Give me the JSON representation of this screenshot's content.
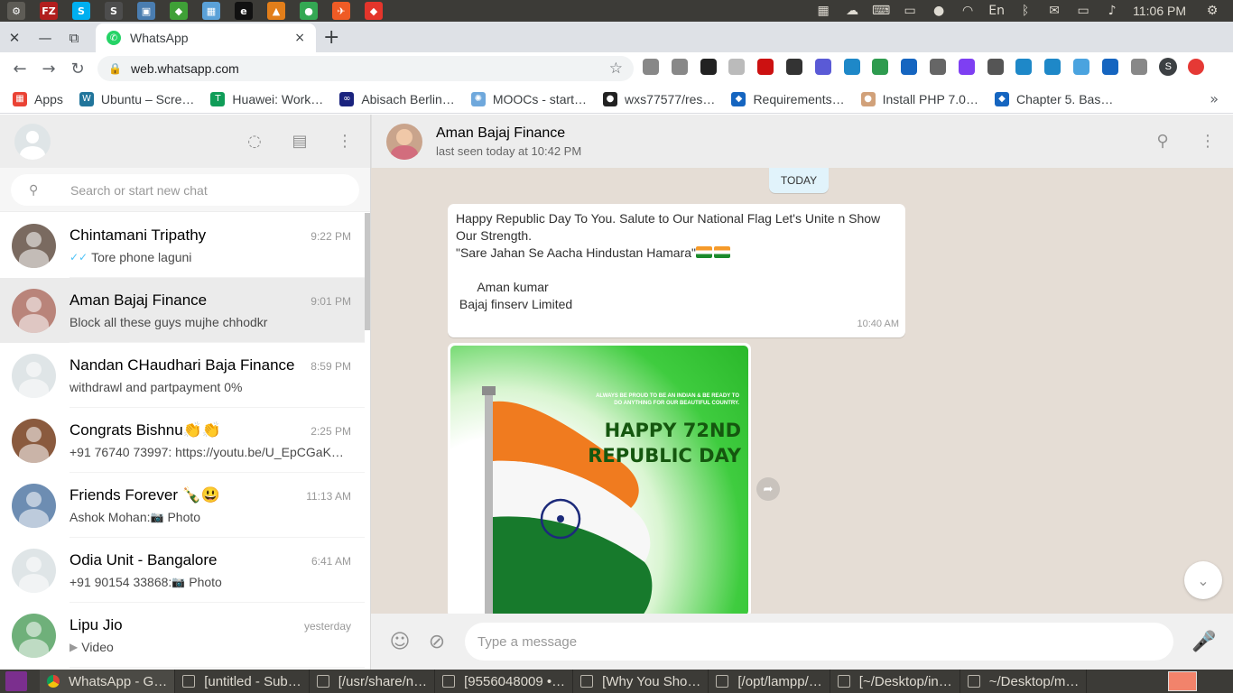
{
  "system_bar": {
    "launchers": [
      {
        "icon": "settings-gear-icon",
        "color": "#5e5c56",
        "glyph": "⚙"
      },
      {
        "icon": "filezilla-icon",
        "color": "#b11e1e",
        "glyph": "FZ"
      },
      {
        "icon": "skype-icon",
        "color": "#00aff0",
        "glyph": "S"
      },
      {
        "icon": "sublime-text-icon",
        "color": "#4d4d4d",
        "glyph": "S"
      },
      {
        "icon": "virtualbox-icon",
        "color": "#4a7db0",
        "glyph": "▣"
      },
      {
        "icon": "mongodb-icon",
        "color": "#3fa037",
        "glyph": "◆"
      },
      {
        "icon": "image-viewer-icon",
        "color": "#5aa1d8",
        "glyph": "▦"
      },
      {
        "icon": "eboard-icon",
        "color": "#111111",
        "glyph": "e"
      },
      {
        "icon": "vlc-icon",
        "color": "#e27e1a",
        "glyph": "▲"
      },
      {
        "icon": "chrome-icon",
        "color": "#34a853",
        "glyph": "●"
      },
      {
        "icon": "postman-icon",
        "color": "#ef5b25",
        "glyph": "✈"
      },
      {
        "icon": "anydesk-icon",
        "color": "#e4352b",
        "glyph": "◆"
      }
    ],
    "tray": [
      {
        "icon": "apps-grid-tray-icon",
        "glyph": "▦"
      },
      {
        "icon": "skype-tray-icon",
        "glyph": "☁"
      },
      {
        "icon": "keyboard-icon",
        "glyph": "⌨"
      },
      {
        "icon": "terminal-icon",
        "glyph": "▭"
      },
      {
        "icon": "red-app-icon",
        "glyph": "●"
      },
      {
        "icon": "wifi-icon",
        "glyph": "◠"
      },
      {
        "icon": "language-icon",
        "glyph": "En"
      },
      {
        "icon": "bluetooth-icon",
        "glyph": "ᛒ"
      },
      {
        "icon": "mail-icon",
        "glyph": "✉"
      },
      {
        "icon": "battery-icon",
        "glyph": "▭"
      },
      {
        "icon": "volume-icon",
        "glyph": "♪"
      }
    ],
    "clock": "11:06 PM",
    "power_glyph": "⚙"
  },
  "browser": {
    "tab_title": "WhatsApp",
    "tab_close": "×",
    "new_tab": "+",
    "url": "web.whatsapp.com",
    "back": "←",
    "forward": "→",
    "reload": "↻",
    "lock": "🔒",
    "star": "☆",
    "close_window": "✕",
    "minimize": "—",
    "restore": "⧉",
    "extension_colors": [
      "#888888",
      "#888888",
      "#222222",
      "#bbbbbb",
      "#cc1111",
      "#333333",
      "#5a5ad6",
      "#1e88c8",
      "#2e9b4f",
      "#1565c0",
      "#666666",
      "#7e3ff2",
      "#555555",
      "#1e88c8",
      "#1e88c8",
      "#4aa3df",
      "#1565c0",
      "#888888"
    ],
    "profile_letter": "S",
    "bookmarks": [
      {
        "label": "Apps",
        "color": "#ea4335",
        "glyph": "▦"
      },
      {
        "label": "Ubuntu – Scre…",
        "color": "#21759b",
        "glyph": "W"
      },
      {
        "label": "Huawei: Work…",
        "color": "#0f9d58",
        "glyph": "T"
      },
      {
        "label": "Abisach Berlin…",
        "color": "#1a237e",
        "glyph": "∞"
      },
      {
        "label": "MOOCs - start…",
        "color": "#6fa8dc",
        "glyph": "✺"
      },
      {
        "label": "wxs77577/res…",
        "color": "#222222",
        "glyph": "●"
      },
      {
        "label": "Requirements…",
        "color": "#1565c0",
        "glyph": "◆"
      },
      {
        "label": "Install PHP 7.0…",
        "color": "#d1a17a",
        "glyph": "●"
      },
      {
        "label": "Chapter 5. Bas…",
        "color": "#1565c0",
        "glyph": "◆"
      }
    ],
    "bookmarks_more": "»"
  },
  "left_panel": {
    "header_icons": [
      "status-icon",
      "new-chat-icon",
      "menu-icon"
    ],
    "header_glyphs": [
      "◌",
      "▤",
      "⋮"
    ],
    "search_placeholder": "Search or start new chat",
    "search_glyph": "⚲",
    "chats": [
      {
        "name": "Chintamani Tripathy",
        "time": "9:22 PM",
        "preview": "Tore phone laguni",
        "status_glyph": "✓✓",
        "status_icon": "double-check-icon",
        "avatar_color": "#7a6a60",
        "active": false
      },
      {
        "name": "Aman Bajaj Finance",
        "time": "9:01 PM",
        "preview": "Block all these guys mujhe chhodkr",
        "status_glyph": "",
        "status_icon": "",
        "avatar_color": "#b9847a",
        "active": true
      },
      {
        "name": "Nandan CHaudhari Baja Finance",
        "time": "8:59 PM",
        "preview": "withdrawl and partpayment 0%",
        "status_glyph": "",
        "status_icon": "",
        "avatar_color": "#dfe5e7",
        "active": false
      },
      {
        "name": "Congrats Bishnu👏👏",
        "time": "2:25 PM",
        "preview": "+91 76740 73997: https://youtu.be/U_EpCGaK…",
        "status_glyph": "",
        "status_icon": "",
        "avatar_color": "#8a5a3e",
        "active": false
      },
      {
        "name": "Friends Forever 🍾😃",
        "time": "11:13 AM",
        "preview": "Ashok Mohan: ",
        "preview_media": "Photo",
        "status_glyph": "📷",
        "status_icon": "camera-icon",
        "avatar_color": "#6d8db2",
        "active": false
      },
      {
        "name": "Odia Unit - Bangalore",
        "time": "6:41 AM",
        "preview": "+91 90154 33868: ",
        "preview_media": "Photo",
        "status_glyph": "📷",
        "status_icon": "camera-icon",
        "avatar_color": "#dfe5e7",
        "active": false
      },
      {
        "name": "Lipu Jio",
        "time": "yesterday",
        "preview": "",
        "preview_media": "Video",
        "status_glyph": "▶",
        "status_icon": "video-icon",
        "avatar_color": "#6fb07a",
        "active": false
      }
    ]
  },
  "conversation": {
    "name": "Aman Bajaj Finance",
    "status": "last seen today at 10:42 PM",
    "header_glyphs": [
      "⚲",
      "⋮"
    ],
    "day_chip": "TODAY",
    "message_text": "Happy Republic Day To You. Salute to Our National Flag Let's Unite n Show Our Strength.\n\"Sare Jahan Se Aacha Hindustan Hamara\"",
    "message_signature": "\n\n      Aman kumar\n Bajaj finserv Limited",
    "message_time": "10:40 AM",
    "poster_tagline": "ALWAYS BE PROUD TO BE AN INDIAN & BE READY TO DO ANYTHING FOR OUR BEAUTIFUL COUNTRY.",
    "poster_heading_1": "HAPPY 72ND",
    "poster_heading_2": "REPUBLIC DAY",
    "forward_glyph": "➦",
    "scroll_glyph": "⌄",
    "composer_placeholder": "Type a message",
    "emoji_glyph": "☺",
    "attach_glyph": "⊘",
    "mic_glyph": "🎤"
  },
  "taskbar": {
    "items": [
      {
        "label": "WhatsApp - G…",
        "icon": "chrome",
        "active": true
      },
      {
        "label": "[untitled - Sub…",
        "icon": "window",
        "active": false
      },
      {
        "label": "[/usr/share/n…",
        "icon": "window",
        "active": false
      },
      {
        "label": "[9556048009 •…",
        "icon": "window",
        "active": false
      },
      {
        "label": "[Why You Sho…",
        "icon": "window",
        "active": false
      },
      {
        "label": "[/opt/lampp/…",
        "icon": "window",
        "active": false
      },
      {
        "label": "[~/Desktop/in…",
        "icon": "window",
        "active": false
      },
      {
        "label": "~/Desktop/m…",
        "icon": "window",
        "active": false
      }
    ]
  }
}
